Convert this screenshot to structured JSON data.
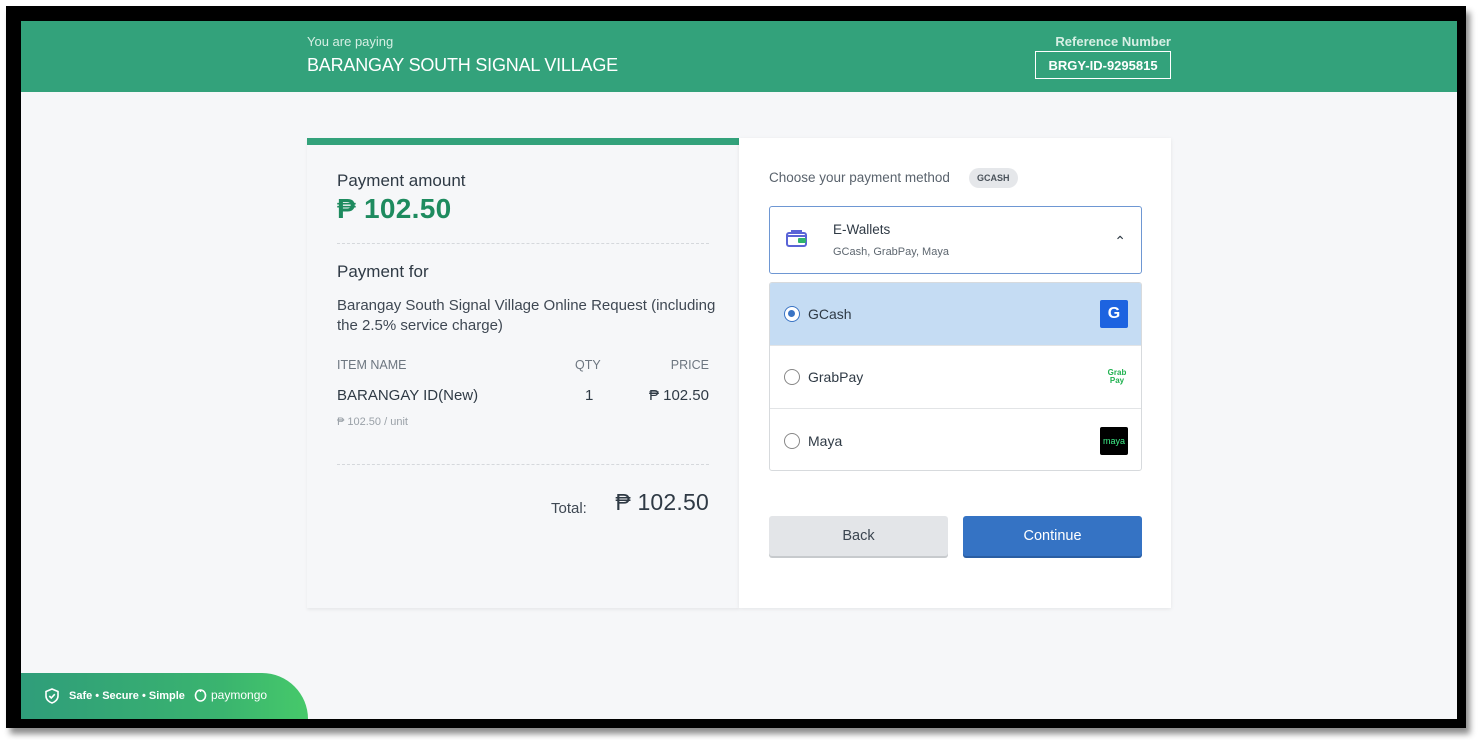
{
  "header": {
    "paying_label": "You are paying",
    "merchant": "BARANGAY SOUTH SIGNAL VILLAGE",
    "reference_label": "Reference Number",
    "reference_number": "BRGY-ID-9295815"
  },
  "summary": {
    "amount_label": "Payment amount",
    "amount": "₱ 102.50",
    "payment_for_label": "Payment for",
    "description": "Barangay South Signal Village Online Request (including the 2.5% service charge)",
    "columns": [
      "ITEM NAME",
      "QTY",
      "PRICE"
    ],
    "items": [
      {
        "name": "BARANGAY ID(New)",
        "qty": "1",
        "price": "₱ 102.50",
        "unit_price": "₱ 102.50 / unit"
      }
    ],
    "total_label": "Total:",
    "total": "₱ 102.50"
  },
  "payment": {
    "choose_label": "Choose your payment method",
    "selected_badge": "GCASH",
    "category_title": "E-Wallets",
    "category_subtitle": "GCash, GrabPay, Maya",
    "options": [
      {
        "label": "GCash",
        "selected": true,
        "logo_text": "G"
      },
      {
        "label": "GrabPay",
        "selected": false,
        "logo_text": "Grab Pay"
      },
      {
        "label": "Maya",
        "selected": false,
        "logo_text": "maya"
      }
    ],
    "back_label": "Back",
    "continue_label": "Continue"
  },
  "footer": {
    "tagline": "Safe • Secure • Simple",
    "brand": "paymongo"
  },
  "colors": {
    "brand_green": "#33a27b",
    "accent_blue": "#3573c4",
    "selected_bg": "#c5dcf3"
  }
}
